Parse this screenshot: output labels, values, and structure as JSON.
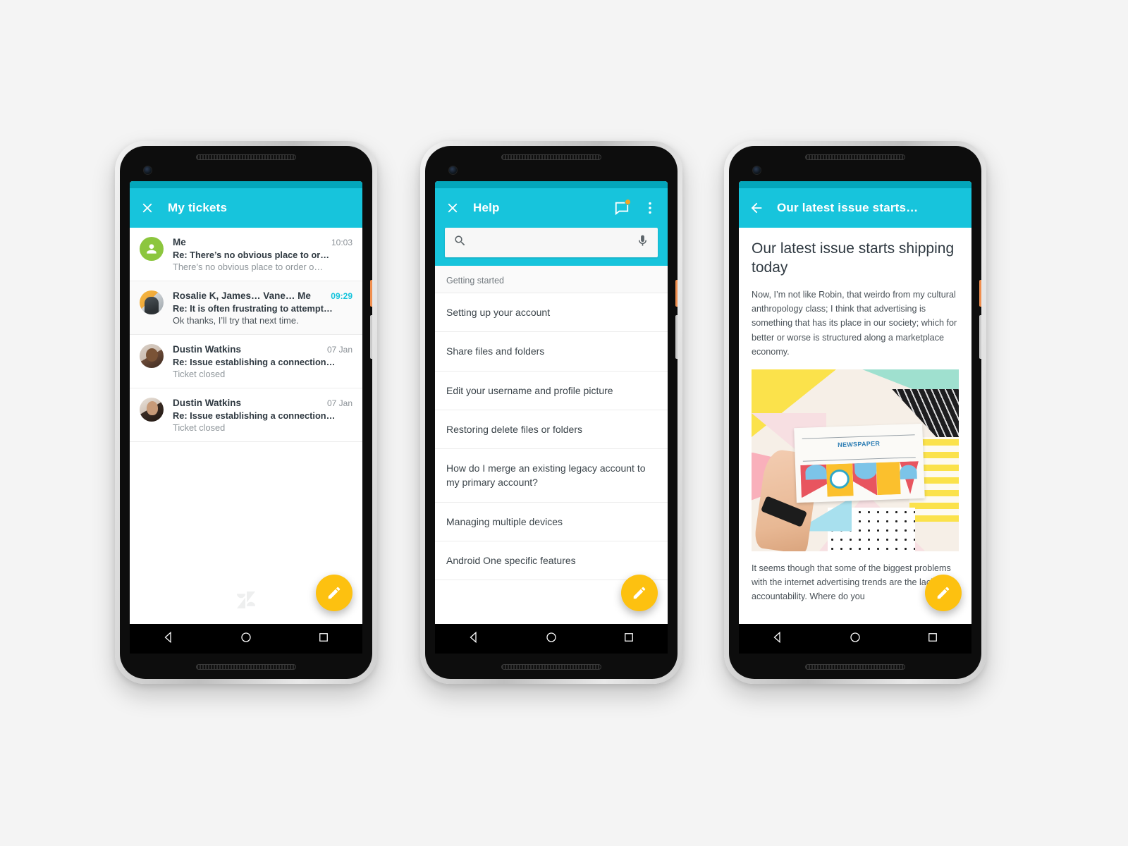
{
  "colors": {
    "appbar": "#17c4dc",
    "statusbar": "#03a6bb",
    "fab": "#fdc110",
    "unread_time": "#17c4dc",
    "me_avatar": "#8cc63e",
    "badge": "#f5a623",
    "page_background": "#f4f4f4"
  },
  "phone1": {
    "appbar": {
      "close_icon": "close-icon",
      "title": "My tickets"
    },
    "tickets": [
      {
        "avatar": "me-avatar-icon",
        "name": "Me",
        "time": "10:03",
        "unread": false,
        "subject": "Re: There’s no obvious place to or…",
        "snippet": "There’s no obvious place to order o…"
      },
      {
        "avatar": "contact-avatar-photo",
        "name": "Rosalie K, James… Vane… Me",
        "time": "09:29",
        "unread": true,
        "subject": "Re: It is often frustrating to attempt…",
        "snippet": "Ok thanks, I’ll try that next time."
      },
      {
        "avatar": "contact-avatar-photo",
        "name": "Dustin Watkins",
        "time": "07 Jan",
        "unread": false,
        "subject": "Re: Issue establishing a connection…",
        "snippet": "Ticket closed"
      },
      {
        "avatar": "contact-avatar-photo",
        "name": "Dustin Watkins",
        "time": "07 Jan",
        "unread": false,
        "subject": "Re: Issue establishing a connection…",
        "snippet": "Ticket closed"
      }
    ],
    "watermark": "zendesk-logo",
    "fab": "compose-pencil-icon"
  },
  "phone2": {
    "appbar": {
      "close_icon": "close-icon",
      "title": "Help",
      "messages_icon": "messages-inbox-icon",
      "overflow_icon": "overflow-menu-icon",
      "badge": true
    },
    "search": {
      "value": "",
      "placeholder": "",
      "search_icon": "search-icon",
      "mic_icon": "microphone-icon"
    },
    "section_label": "Getting started",
    "help_items": [
      "Setting up your account",
      "Share files and folders",
      "Edit your username and profile picture",
      "Restoring delete files or folders",
      "How do I merge an existing legacy account to my primary account?",
      "Managing multiple devices",
      "Android One specific features"
    ],
    "fab": "compose-pencil-icon"
  },
  "phone3": {
    "appbar": {
      "back_icon": "back-arrow-icon",
      "title": "Our latest issue starts…"
    },
    "article": {
      "title": "Our latest issue starts shipping today",
      "paragraph1": "Now, I’m not like Robin, that weirdo from my cultural anthropology class; I think that advertising is something that has its place in our society; which for better or worse is structured along a marketplace economy.",
      "image_alt": "colorful-geometric-collage-photo",
      "image_caption_text": "NEWSPAPER",
      "paragraph2": "It seems though that some of the biggest problems with the internet advertising trends are the lack of accountability. Where do you"
    },
    "fab": "compose-pencil-icon"
  },
  "navbar": {
    "back": "nav-back-icon",
    "home": "nav-home-icon",
    "recents": "nav-recents-icon"
  }
}
